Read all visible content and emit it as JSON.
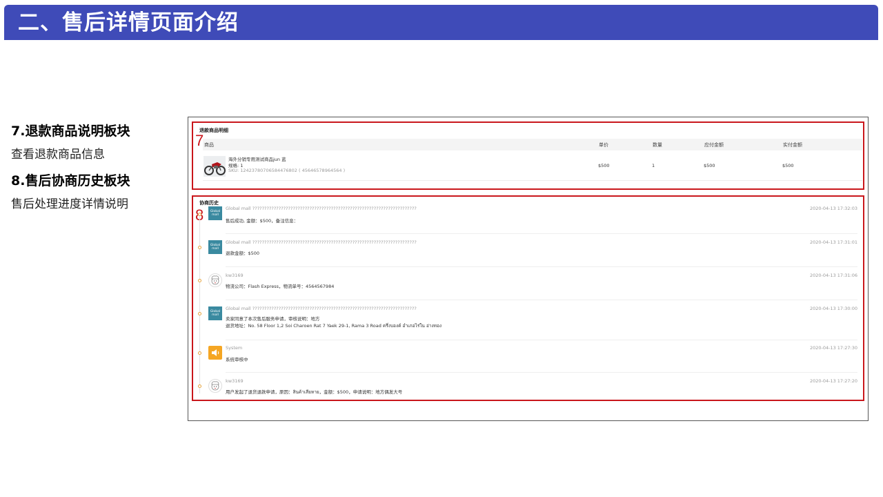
{
  "slide": {
    "title": "二、售后详情页面介绍",
    "notes": [
      {
        "head": "7.退款商品说明板块",
        "text": "查看退款商品信息"
      },
      {
        "head": "8.售后协商历史板块",
        "text": "售后处理进度详情说明"
      }
    ]
  },
  "markers": {
    "seven": "7",
    "eight": "8"
  },
  "colors": {
    "title_bar": "#3f4bb8",
    "highlight_box": "#c9161b",
    "timeline_dot": "#e6a23c",
    "avatar_global": "#3a8aa0",
    "avatar_system": "#f5a623"
  },
  "products": {
    "title": "退款商品明细",
    "columns": [
      "商品",
      "单价",
      "数量",
      "应付金额",
      "实付金额"
    ],
    "item": {
      "name": "海外分销专用测试商品jun 蓝",
      "spec": "规格: 1",
      "sku": "SKU: 124237807065844768​02 ( 45646578964564 )",
      "price": "$500",
      "qty": "1",
      "payable": "$500",
      "paid": "$500",
      "image_icon": "motorcycle-image"
    }
  },
  "history": {
    "title": "协商历史",
    "entries": [
      {
        "name": "Global mall ?????????????????????????????????????????????????????????????????????",
        "time": "2020-04-13 17:32:03",
        "lines": [
          "售后成功, 金额：$500，备注信息："
        ],
        "avatar": "global",
        "avatar_label": "Global mall"
      },
      {
        "name": "Global mall ?????????????????????????????????????????????????????????????????????",
        "time": "2020-04-13 17:31:01",
        "lines": [
          "退款金额：$500"
        ],
        "avatar": "global",
        "avatar_label": "Global mall"
      },
      {
        "name": "kw3169",
        "time": "2020-04-13 17:31:06",
        "lines": [
          "物流公司：Flash Express，物流单号：4564567984"
        ],
        "avatar": "user",
        "avatar_label": ""
      },
      {
        "name": "Global mall ?????????????????????????????????????????????????????????????????????",
        "time": "2020-04-13 17:30:00",
        "lines": [
          "卖家同意了本次售后服务申请，审核说明：地方",
          "退货地址：No. 58 Floor 1,2 Soi Charoen Rat 7 Yaek 29-1, Rama 3 Road ครึ่งบองค์ อำเภอไร่ใน อ่างทอง"
        ],
        "avatar": "global",
        "avatar_label": "Global mall"
      },
      {
        "name": "System",
        "time": "2020-04-13 17:27:30",
        "lines": [
          "系统审核中"
        ],
        "avatar": "system",
        "avatar_label": ""
      },
      {
        "name": "kw3169",
        "time": "2020-04-13 17:27:20",
        "lines": [
          "用户发起了退货退款申请，原因：สินค้าเสียหาย，金额：$500，申请说明：地方偶发大号"
        ],
        "avatar": "user",
        "avatar_label": ""
      }
    ]
  }
}
